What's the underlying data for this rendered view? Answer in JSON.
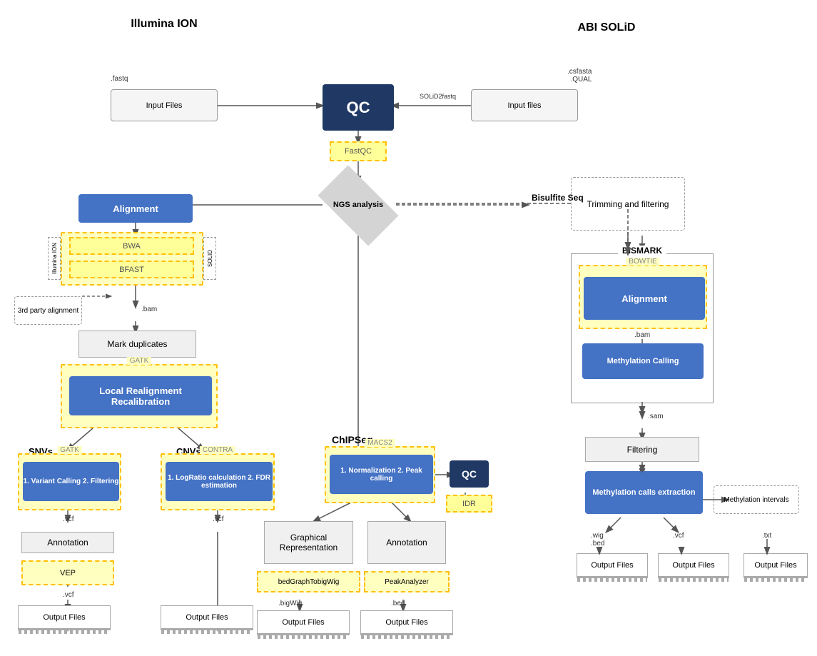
{
  "titles": {
    "illumina_ion": "Illumina\nION",
    "abi_solid": "ABI SOLiD",
    "fastq": ".fastq",
    "csfasta_qual": ".csfasta\n.QUAL",
    "solid2fastq": "SOLiD2fastq",
    "input_files_left": "Input Files",
    "input_files_right": "Input files",
    "qc": "QC",
    "fastqc": "FastQC",
    "ngs_analysis": "NGS\nanalysis",
    "bisulfite_seq": "Bisulfite\nSeq",
    "trimming_filtering": "Trimming\nand\nfiltering",
    "alignment": "Alignment",
    "bwa": "BWA",
    "bfast": "BFAST",
    "illumina_ion_label": "Illumina\nION",
    "solid_label": "SOLID",
    "third_party": "3rd party\nalignment",
    "bam": ".bam",
    "mark_duplicates": "Mark duplicates",
    "gatk_container": "GATK",
    "local_realign": "Local Realignment\nRecalibration",
    "snvs": "SNVs",
    "cnvs": "CNVs",
    "gatk_snv": "GATK",
    "contra": "CONTRA",
    "variant_calling": "1. Variant Calling\n2. Filtering",
    "logratio": "1. LogRatio calculation\n2. FDR estimation",
    "vcf1": ".vcf",
    "vcf2": ".vcf",
    "vcf3": ".vcf",
    "annotation_left": "Annotation",
    "vep": "VEP",
    "output_files_1": "Output Files",
    "output_files_2": "Output Files",
    "chipseq": "ChIPSeq",
    "macs2_container": "MACS2",
    "norm_peak": "1. Normalization\n2. Peak calling",
    "qc2": "QC",
    "idr": "IDR",
    "graphical_rep": "Graphical\nRepresentation",
    "annotation_right": "Annotation",
    "bedgraph": "bedGraphTobigWig",
    "bigwig": ".bigWig",
    "peakanalyzer": "PeakAnalyzer",
    "bed": ".bed",
    "output_files_3": "Output Files",
    "output_files_4": "Output Files",
    "bismark": "BISMARK",
    "bowtie": "BOWTIE",
    "alignment_bs": "Alignment",
    "bam_bs": ".bam",
    "methylation_calling": "Methylation\nCalling",
    "sam": ".sam",
    "filtering_bs": "Filtering",
    "methylation_extraction": "Methylation\ncalls extraction",
    "methylation_intervals": "Methylation\nintervals",
    "wig_bed": ".wig\n.bed",
    "vcf_bs": ".vcf",
    "txt": ".txt",
    "output_files_5": "Output Files",
    "output_files_6": "Output Files",
    "output_files_7": "Output Files"
  },
  "colors": {
    "blue": "#4472C4",
    "dark_blue": "#1F3864",
    "yellow_bg": "#FFFFC0",
    "yellow_border": "#FFC000",
    "gray_box": "#f0f0f0",
    "diamond_gray": "#d4d4d4"
  }
}
